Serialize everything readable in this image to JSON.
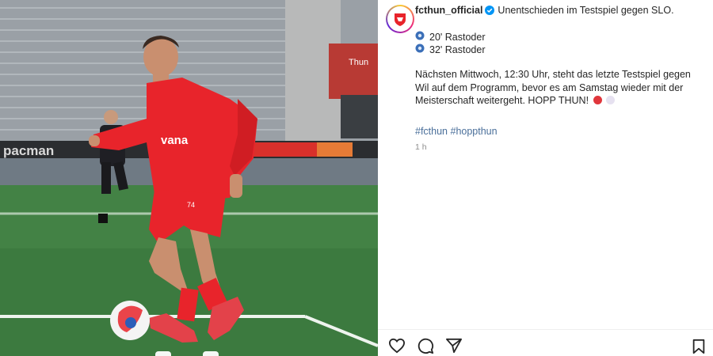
{
  "post": {
    "username": "fcthun_official",
    "title_text": "Unentschieden im Testspiel gegen SLO.",
    "goals": [
      {
        "minute_text": "20' Rastoder",
        "icon": "soccer-ball-icon"
      },
      {
        "minute_text": "32' Rastoder",
        "icon": "soccer-ball-icon"
      }
    ],
    "paragraph": "Nächsten Mittwoch, 12:30 Uhr, steht das letzte Testspiel gegen Wil auf dem Programm, bevor es am Samstag wieder mit der Meisterschaft weitergeht. HOPP THUN!",
    "hashtags": [
      "#fcthun",
      "#hoppthun"
    ],
    "time_ago": "1 h"
  },
  "photo": {
    "banner_left": "pacman",
    "shirt_sponsor": "vana",
    "shirt_number": "74",
    "stadium_sign": "Thun"
  },
  "colors": {
    "accent_red": "#e8242b",
    "link_blue": "#00376b",
    "verified_blue": "#0095f6",
    "pitch_green": "#3c7a3f"
  },
  "actions": {
    "like": "heart-icon",
    "comment": "comment-icon",
    "share": "share-icon",
    "save": "bookmark-icon"
  }
}
